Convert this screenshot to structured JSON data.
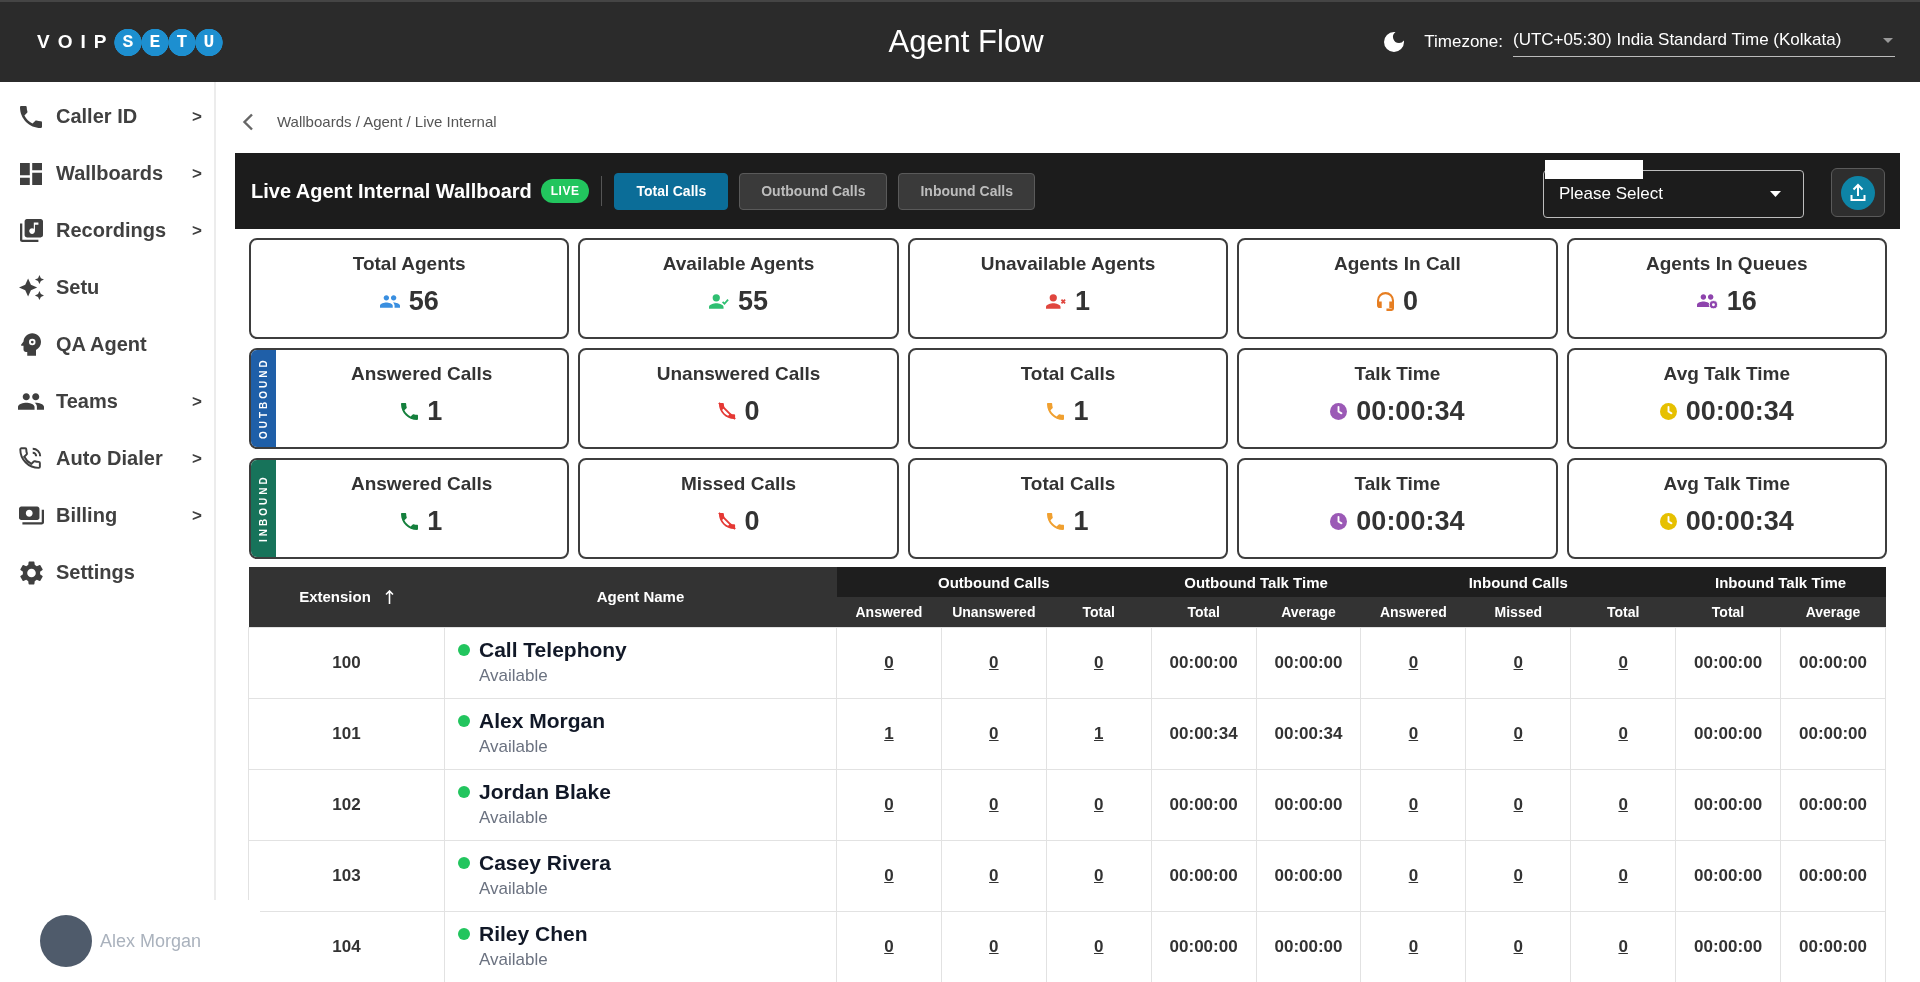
{
  "header": {
    "logo": {
      "text": "VOIP",
      "badge": "SETU"
    },
    "title": "Agent Flow",
    "timezone": {
      "label": "Timezone:",
      "value": "(UTC+05:30) India Standard Time (Kolkata)"
    }
  },
  "sidebar": {
    "items": [
      {
        "kind": "caller_id",
        "label": "Caller ID",
        "arrow": ">"
      },
      {
        "kind": "wallboards",
        "label": "Wallboards",
        "arrow": ">"
      },
      {
        "kind": "recordings",
        "label": "Recordings",
        "arrow": ">"
      },
      {
        "kind": "setu",
        "label": "Setu"
      },
      {
        "kind": "qa_agent",
        "label": "QA Agent"
      },
      {
        "kind": "teams",
        "label": "Teams",
        "arrow": ">"
      },
      {
        "kind": "auto_dialer",
        "label": "Auto Dialer",
        "arrow": ">"
      },
      {
        "kind": "billing",
        "label": "Billing",
        "arrow": ">"
      },
      {
        "kind": "settings",
        "label": "Settings"
      }
    ],
    "user": {
      "name": "Alex Morgan"
    }
  },
  "breadcrumb": "Wallboards / Agent / Live Internal",
  "wallboard": {
    "title": "Live Agent Internal Wallboard",
    "badge": "LIVE",
    "tabs": [
      {
        "label": "Total Calls",
        "selected": true
      },
      {
        "label": "Outbound Calls",
        "selected": false
      },
      {
        "label": "Inbound Calls",
        "selected": false
      }
    ],
    "filter": {
      "placeholder": "Please Select"
    }
  },
  "stat_rows": [
    {
      "cards": [
        {
          "kind": "total_agents",
          "title": "Total Agents",
          "value": "56"
        },
        {
          "kind": "available_agents",
          "title": "Available Agents",
          "value": "55"
        },
        {
          "kind": "unavailable_agents",
          "title": "Unavailable Agents",
          "value": "1"
        },
        {
          "kind": "agents_in_call",
          "title": "Agents In Call",
          "value": "0"
        },
        {
          "kind": "agents_in_queues",
          "title": "Agents In Queues",
          "value": "16"
        }
      ]
    },
    {
      "label": "OUTBOUND",
      "color": "#1f5fa8",
      "cards": [
        {
          "kind": "answered",
          "title": "Answered Calls",
          "value": "1"
        },
        {
          "kind": "unanswered",
          "title": "Unanswered Calls",
          "value": "0"
        },
        {
          "kind": "total",
          "title": "Total Calls",
          "value": "1"
        },
        {
          "kind": "talk_time",
          "title": "Talk Time",
          "value": "00:00:34"
        },
        {
          "kind": "avg_talk_time",
          "title": "Avg Talk Time",
          "value": "00:00:34"
        }
      ]
    },
    {
      "label": "INBOUND",
      "color": "#17735a",
      "cards": [
        {
          "kind": "answered",
          "title": "Answered Calls",
          "value": "1"
        },
        {
          "kind": "missed",
          "title": "Missed Calls",
          "value": "0"
        },
        {
          "kind": "total",
          "title": "Total Calls",
          "value": "1"
        },
        {
          "kind": "talk_time",
          "title": "Talk Time",
          "value": "00:00:34"
        },
        {
          "kind": "avg_talk_time",
          "title": "Avg Talk Time",
          "value": "00:00:34"
        }
      ]
    }
  ],
  "table": {
    "columns": [
      {
        "label": "Extension",
        "sorted": true
      },
      {
        "label": "Agent Name",
        "sorted": false
      }
    ],
    "groups": [
      {
        "label": "Outbound Calls",
        "kind": "count",
        "columns": [
          "Answered",
          "Unanswered",
          "Total"
        ]
      },
      {
        "label": "Outbound Talk Time",
        "kind": "time",
        "columns": [
          "Total",
          "Average"
        ]
      },
      {
        "label": "Inbound Calls",
        "kind": "count",
        "columns": [
          "Answered",
          "Missed",
          "Total"
        ]
      },
      {
        "label": "Inbound Talk Time",
        "kind": "time",
        "columns": [
          "Total",
          "Average"
        ]
      }
    ],
    "rows": [
      {
        "extension": "100",
        "agent": {
          "name": "Call Telephony",
          "status": "Available",
          "color": "#22c55e"
        },
        "values": [
          [
            "0",
            "0",
            "0"
          ],
          [
            "00:00:00",
            "00:00:00"
          ],
          [
            "0",
            "0",
            "0"
          ],
          [
            "00:00:00",
            "00:00:00"
          ]
        ]
      },
      {
        "extension": "101",
        "agent": {
          "name": "Alex Morgan",
          "status": "Available",
          "color": "#22c55e"
        },
        "values": [
          [
            "1",
            "0",
            "1"
          ],
          [
            "00:00:34",
            "00:00:34"
          ],
          [
            "0",
            "0",
            "0"
          ],
          [
            "00:00:00",
            "00:00:00"
          ]
        ]
      },
      {
        "extension": "102",
        "agent": {
          "name": "Jordan Blake",
          "status": "Available",
          "color": "#22c55e"
        },
        "values": [
          [
            "0",
            "0",
            "0"
          ],
          [
            "00:00:00",
            "00:00:00"
          ],
          [
            "0",
            "0",
            "0"
          ],
          [
            "00:00:00",
            "00:00:00"
          ]
        ]
      },
      {
        "extension": "103",
        "agent": {
          "name": "Casey Rivera",
          "status": "Available",
          "color": "#22c55e"
        },
        "values": [
          [
            "0",
            "0",
            "0"
          ],
          [
            "00:00:00",
            "00:00:00"
          ],
          [
            "0",
            "0",
            "0"
          ],
          [
            "00:00:00",
            "00:00:00"
          ]
        ]
      },
      {
        "extension": "104",
        "agent": {
          "name": "Riley Chen",
          "status": "Available",
          "color": "#22c55e"
        },
        "values": [
          [
            "0",
            "0",
            "0"
          ],
          [
            "00:00:00",
            "00:00:00"
          ],
          [
            "0",
            "0",
            "0"
          ],
          [
            "00:00:00",
            "00:00:00"
          ]
        ]
      }
    ]
  }
}
